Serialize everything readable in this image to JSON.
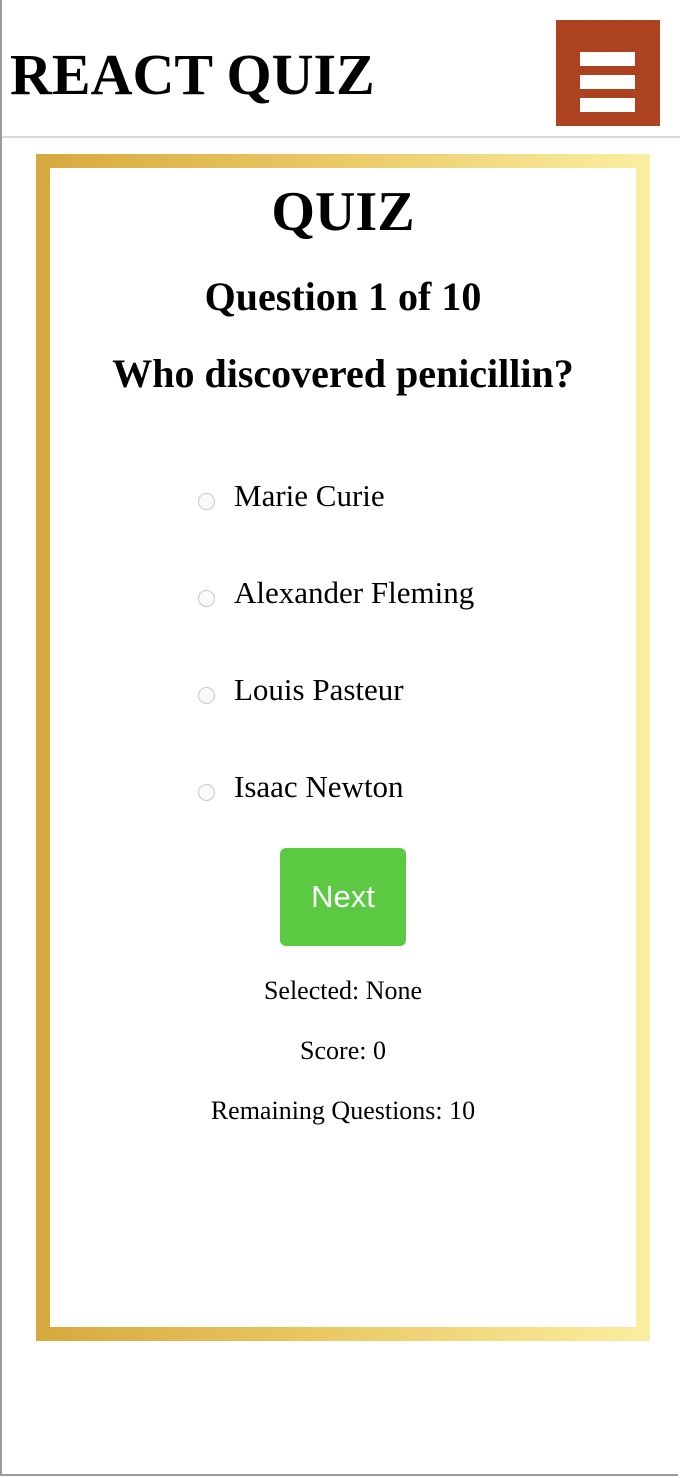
{
  "header": {
    "app_title": "REACT QUIZ",
    "menu_icon": "hamburger-menu-icon",
    "menu_color": "#ad4220"
  },
  "quiz": {
    "heading": "QUIZ",
    "counter": "Question 1 of 10",
    "question": "Who discovered penicillin?",
    "options": [
      {
        "label": "Marie Curie",
        "selected": false
      },
      {
        "label": "Alexander Fleming",
        "selected": false
      },
      {
        "label": "Louis Pasteur",
        "selected": false
      },
      {
        "label": "Isaac Newton",
        "selected": false
      }
    ],
    "next_label": "Next",
    "next_color": "#5bc941"
  },
  "stats": {
    "selected": "Selected: None",
    "score": "Score: 0",
    "remaining": "Remaining Questions: 10"
  },
  "colors": {
    "border_gradient_start": "#d6a93e",
    "border_gradient_end": "#fbeea0"
  }
}
